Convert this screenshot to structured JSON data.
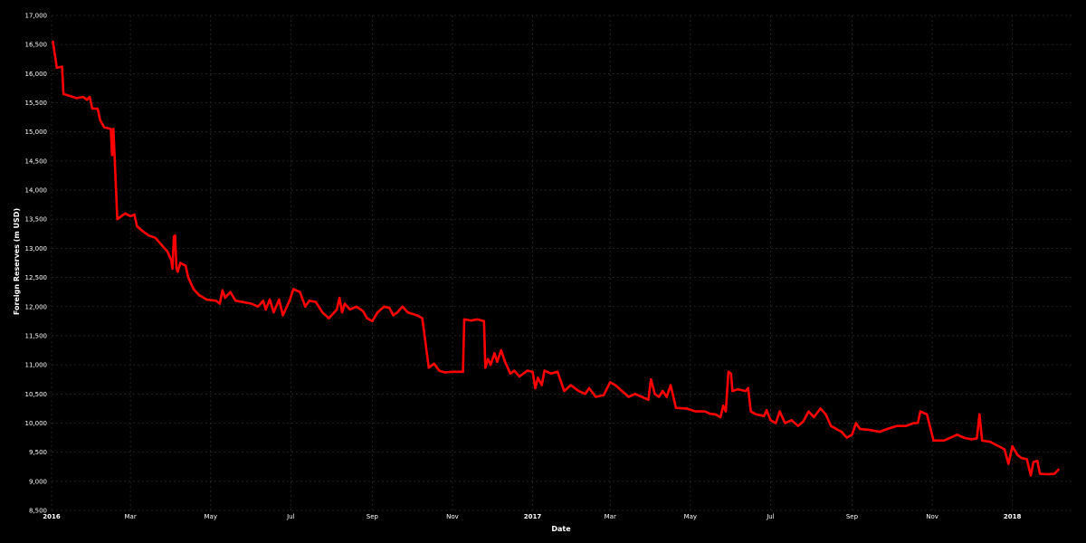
{
  "chart_data": {
    "type": "line",
    "xlabel": "Date",
    "ylabel": "Foreign Reserves (m USD)",
    "ylim": [
      8500,
      17000
    ],
    "xlim": [
      "2016-01-01",
      "2018-02-15"
    ],
    "grid": true,
    "colors": {
      "background": "#000000",
      "line": "#ff0000",
      "grid": "#2a2a2a",
      "text": "#ffffff"
    },
    "y_ticks": [
      {
        "value": 8500,
        "label": "8,500"
      },
      {
        "value": 9000,
        "label": "9,000"
      },
      {
        "value": 9500,
        "label": "9,500"
      },
      {
        "value": 10000,
        "label": "10,000"
      },
      {
        "value": 10500,
        "label": "10,500"
      },
      {
        "value": 11000,
        "label": "11,000"
      },
      {
        "value": 11500,
        "label": "11,500"
      },
      {
        "value": 12000,
        "label": "12,000"
      },
      {
        "value": 12500,
        "label": "12,500"
      },
      {
        "value": 13000,
        "label": "13,000"
      },
      {
        "value": 13500,
        "label": "13,500"
      },
      {
        "value": 14000,
        "label": "14,000"
      },
      {
        "value": 14500,
        "label": "14,500"
      },
      {
        "value": 15000,
        "label": "15,000"
      },
      {
        "value": 15500,
        "label": "15,500"
      },
      {
        "value": 16000,
        "label": "16,000"
      },
      {
        "value": 16500,
        "label": "16,500"
      },
      {
        "value": 17000,
        "label": "17,000"
      }
    ],
    "x_ticks": [
      {
        "date": "2016-01-01",
        "label": "2016",
        "bold": true
      },
      {
        "date": "2016-03-01",
        "label": "Mar",
        "bold": false
      },
      {
        "date": "2016-05-01",
        "label": "May",
        "bold": false
      },
      {
        "date": "2016-07-01",
        "label": "Jul",
        "bold": false
      },
      {
        "date": "2016-09-01",
        "label": "Sep",
        "bold": false
      },
      {
        "date": "2016-11-01",
        "label": "Nov",
        "bold": false
      },
      {
        "date": "2017-01-01",
        "label": "2017",
        "bold": true
      },
      {
        "date": "2017-03-01",
        "label": "Mar",
        "bold": false
      },
      {
        "date": "2017-05-01",
        "label": "May",
        "bold": false
      },
      {
        "date": "2017-07-01",
        "label": "Jul",
        "bold": false
      },
      {
        "date": "2017-09-01",
        "label": "Sep",
        "bold": false
      },
      {
        "date": "2017-11-01",
        "label": "Nov",
        "bold": false
      },
      {
        "date": "2018-01-01",
        "label": "2018",
        "bold": true
      }
    ],
    "series": [
      {
        "points": [
          [
            "2016-01-02",
            16550
          ],
          [
            "2016-01-03",
            16400
          ],
          [
            "2016-01-05",
            16100
          ],
          [
            "2016-01-09",
            16120
          ],
          [
            "2016-01-10",
            15650
          ],
          [
            "2016-01-20",
            15580
          ],
          [
            "2016-01-25",
            15600
          ],
          [
            "2016-01-28",
            15550
          ],
          [
            "2016-01-30",
            15600
          ],
          [
            "2016-02-01",
            15400
          ],
          [
            "2016-02-05",
            15400
          ],
          [
            "2016-02-07",
            15200
          ],
          [
            "2016-02-10",
            15080
          ],
          [
            "2016-02-15",
            15050
          ],
          [
            "2016-02-16",
            14600
          ],
          [
            "2016-02-17",
            15050
          ],
          [
            "2016-02-18",
            14550
          ],
          [
            "2016-02-20",
            13500
          ],
          [
            "2016-02-23",
            13550
          ],
          [
            "2016-02-26",
            13600
          ],
          [
            "2016-03-01",
            13550
          ],
          [
            "2016-03-04",
            13580
          ],
          [
            "2016-03-06",
            13380
          ],
          [
            "2016-03-10",
            13300
          ],
          [
            "2016-03-15",
            13220
          ],
          [
            "2016-03-20",
            13180
          ],
          [
            "2016-03-25",
            13050
          ],
          [
            "2016-03-29",
            12950
          ],
          [
            "2016-04-01",
            12800
          ],
          [
            "2016-04-02",
            12650
          ],
          [
            "2016-04-03",
            13200
          ],
          [
            "2016-04-04",
            13220
          ],
          [
            "2016-04-05",
            12650
          ],
          [
            "2016-04-06",
            12600
          ],
          [
            "2016-04-08",
            12750
          ],
          [
            "2016-04-12",
            12700
          ],
          [
            "2016-04-14",
            12500
          ],
          [
            "2016-04-18",
            12300
          ],
          [
            "2016-04-22",
            12200
          ],
          [
            "2016-04-28",
            12120
          ],
          [
            "2016-05-05",
            12100
          ],
          [
            "2016-05-08",
            12050
          ],
          [
            "2016-05-10",
            12280
          ],
          [
            "2016-05-12",
            12150
          ],
          [
            "2016-05-16",
            12250
          ],
          [
            "2016-05-20",
            12100
          ],
          [
            "2016-06-01",
            12050
          ],
          [
            "2016-06-06",
            12000
          ],
          [
            "2016-06-10",
            12100
          ],
          [
            "2016-06-12",
            11950
          ],
          [
            "2016-06-15",
            12120
          ],
          [
            "2016-06-18",
            11900
          ],
          [
            "2016-06-22",
            12120
          ],
          [
            "2016-06-25",
            11850
          ],
          [
            "2016-06-30",
            12100
          ],
          [
            "2016-07-03",
            12300
          ],
          [
            "2016-07-08",
            12250
          ],
          [
            "2016-07-12",
            12000
          ],
          [
            "2016-07-15",
            12100
          ],
          [
            "2016-07-20",
            12080
          ],
          [
            "2016-07-25",
            11900
          ],
          [
            "2016-07-30",
            11800
          ],
          [
            "2016-08-05",
            11950
          ],
          [
            "2016-08-07",
            12150
          ],
          [
            "2016-08-09",
            11900
          ],
          [
            "2016-08-11",
            12050
          ],
          [
            "2016-08-15",
            11950
          ],
          [
            "2016-08-20",
            12000
          ],
          [
            "2016-08-25",
            11920
          ],
          [
            "2016-08-28",
            11800
          ],
          [
            "2016-09-01",
            11750
          ],
          [
            "2016-09-05",
            11900
          ],
          [
            "2016-09-10",
            12000
          ],
          [
            "2016-09-14",
            11980
          ],
          [
            "2016-09-17",
            11850
          ],
          [
            "2016-09-20",
            11900
          ],
          [
            "2016-09-24",
            12000
          ],
          [
            "2016-09-28",
            11900
          ],
          [
            "2016-10-05",
            11850
          ],
          [
            "2016-10-09",
            11800
          ],
          [
            "2016-10-14",
            10950
          ],
          [
            "2016-10-18",
            11020
          ],
          [
            "2016-10-22",
            10900
          ],
          [
            "2016-10-26",
            10870
          ],
          [
            "2016-11-01",
            10880
          ],
          [
            "2016-11-09",
            10880
          ],
          [
            "2016-11-10",
            11780
          ],
          [
            "2016-11-15",
            11760
          ],
          [
            "2016-11-20",
            11780
          ],
          [
            "2016-11-25",
            11750
          ],
          [
            "2016-11-26",
            10950
          ],
          [
            "2016-11-28",
            11100
          ],
          [
            "2016-11-30",
            11000
          ],
          [
            "2016-12-03",
            11200
          ],
          [
            "2016-12-05",
            11050
          ],
          [
            "2016-12-08",
            11250
          ],
          [
            "2016-12-11",
            11050
          ],
          [
            "2016-12-15",
            10850
          ],
          [
            "2016-12-18",
            10900
          ],
          [
            "2016-12-22",
            10800
          ],
          [
            "2016-12-28",
            10900
          ],
          [
            "2017-01-01",
            10880
          ],
          [
            "2017-01-03",
            10600
          ],
          [
            "2017-01-05",
            10780
          ],
          [
            "2017-01-08",
            10650
          ],
          [
            "2017-01-10",
            10900
          ],
          [
            "2017-01-15",
            10850
          ],
          [
            "2017-01-20",
            10880
          ],
          [
            "2017-01-25",
            10550
          ],
          [
            "2017-01-30",
            10650
          ],
          [
            "2017-02-05",
            10550
          ],
          [
            "2017-02-10",
            10500
          ],
          [
            "2017-02-13",
            10600
          ],
          [
            "2017-02-18",
            10450
          ],
          [
            "2017-02-24",
            10480
          ],
          [
            "2017-03-01",
            10700
          ],
          [
            "2017-03-05",
            10650
          ],
          [
            "2017-03-10",
            10550
          ],
          [
            "2017-03-15",
            10450
          ],
          [
            "2017-03-20",
            10500
          ],
          [
            "2017-03-25",
            10450
          ],
          [
            "2017-03-30",
            10400
          ],
          [
            "2017-04-01",
            10750
          ],
          [
            "2017-04-04",
            10500
          ],
          [
            "2017-04-07",
            10450
          ],
          [
            "2017-04-10",
            10550
          ],
          [
            "2017-04-13",
            10450
          ],
          [
            "2017-04-16",
            10650
          ],
          [
            "2017-04-20",
            10260
          ],
          [
            "2017-04-28",
            10250
          ],
          [
            "2017-05-05",
            10200
          ],
          [
            "2017-05-12",
            10200
          ],
          [
            "2017-05-16",
            10160
          ],
          [
            "2017-05-20",
            10150
          ],
          [
            "2017-05-24",
            10100
          ],
          [
            "2017-05-26",
            10300
          ],
          [
            "2017-05-28",
            10200
          ],
          [
            "2017-05-30",
            10880
          ],
          [
            "2017-06-01",
            10850
          ],
          [
            "2017-06-02",
            10550
          ],
          [
            "2017-06-06",
            10580
          ],
          [
            "2017-06-12",
            10550
          ],
          [
            "2017-06-14",
            10600
          ],
          [
            "2017-06-16",
            10200
          ],
          [
            "2017-06-20",
            10150
          ],
          [
            "2017-06-26",
            10120
          ],
          [
            "2017-06-28",
            10220
          ],
          [
            "2017-07-01",
            10050
          ],
          [
            "2017-07-05",
            10000
          ],
          [
            "2017-07-08",
            10200
          ],
          [
            "2017-07-12",
            10000
          ],
          [
            "2017-07-17",
            10050
          ],
          [
            "2017-07-22",
            9950
          ],
          [
            "2017-07-26",
            10030
          ],
          [
            "2017-07-30",
            10200
          ],
          [
            "2017-08-03",
            10100
          ],
          [
            "2017-08-08",
            10250
          ],
          [
            "2017-08-12",
            10150
          ],
          [
            "2017-08-16",
            9950
          ],
          [
            "2017-08-20",
            9900
          ],
          [
            "2017-08-24",
            9850
          ],
          [
            "2017-08-28",
            9750
          ],
          [
            "2017-09-01",
            9800
          ],
          [
            "2017-09-04",
            10000
          ],
          [
            "2017-09-07",
            9900
          ],
          [
            "2017-09-15",
            9880
          ],
          [
            "2017-09-22",
            9850
          ],
          [
            "2017-09-28",
            9900
          ],
          [
            "2017-10-05",
            9950
          ],
          [
            "2017-10-12",
            9950
          ],
          [
            "2017-10-18",
            10000
          ],
          [
            "2017-10-21",
            10000
          ],
          [
            "2017-10-23",
            10200
          ],
          [
            "2017-10-28",
            10150
          ],
          [
            "2017-11-02",
            9700
          ],
          [
            "2017-11-10",
            9700
          ],
          [
            "2017-11-15",
            9750
          ],
          [
            "2017-11-20",
            9800
          ],
          [
            "2017-11-25",
            9750
          ],
          [
            "2017-12-01",
            9720
          ],
          [
            "2017-12-05",
            9740
          ],
          [
            "2017-12-07",
            10150
          ],
          [
            "2017-12-09",
            9700
          ],
          [
            "2017-12-15",
            9680
          ],
          [
            "2017-12-20",
            9620
          ],
          [
            "2017-12-26",
            9550
          ],
          [
            "2017-12-29",
            9300
          ],
          [
            "2018-01-01",
            9600
          ],
          [
            "2018-01-05",
            9450
          ],
          [
            "2018-01-08",
            9400
          ],
          [
            "2018-01-12",
            9380
          ],
          [
            "2018-01-15",
            9100
          ],
          [
            "2018-01-17",
            9330
          ],
          [
            "2018-01-20",
            9350
          ],
          [
            "2018-01-22",
            9130
          ],
          [
            "2018-01-28",
            9120
          ],
          [
            "2018-02-02",
            9130
          ],
          [
            "2018-02-05",
            9200
          ]
        ]
      }
    ]
  }
}
